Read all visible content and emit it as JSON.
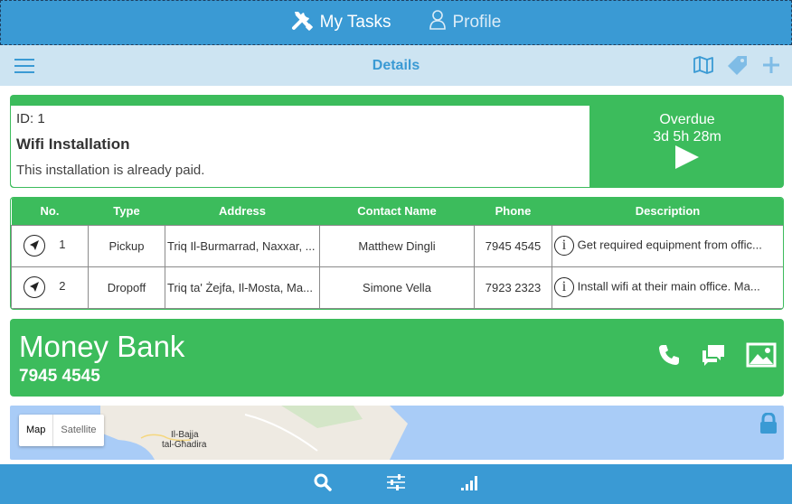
{
  "topbar": {
    "tabs": [
      {
        "label": "My Tasks",
        "icon": "tools-icon",
        "active": true
      },
      {
        "label": "Profile",
        "icon": "user-icon",
        "active": false
      }
    ]
  },
  "subbar": {
    "title": "Details",
    "icons": [
      "menu-icon",
      "map-icon",
      "tag-icon",
      "plus-icon"
    ]
  },
  "task": {
    "id": "ID: 1",
    "name": "Wifi Installation",
    "description": "This installation is already paid.",
    "status": "Overdue",
    "timer": "3d 5h 28m"
  },
  "stops": {
    "headers": [
      "No.",
      "Type",
      "Address",
      "Contact Name",
      "Phone",
      "Description"
    ],
    "rows": [
      {
        "no": "1",
        "type": "Pickup",
        "address": "Triq Il-Burmarrad, Naxxar, ...",
        "contact": "Matthew Dingli",
        "phone": "7945 4545",
        "description": "Get required equipment from offic..."
      },
      {
        "no": "2",
        "type": "Dropoff",
        "address": "Triq ta' Żejfa, Il-Mosta, Ma...",
        "contact": "Simone Vella",
        "phone": "7923 2323",
        "description": "Install wifi at their main office. Ma..."
      }
    ]
  },
  "company": {
    "name": "Money Bank",
    "phone": "7945 4545",
    "icons": [
      "phone-icon",
      "chat-icon",
      "image-icon"
    ]
  },
  "map": {
    "type_map": "Map",
    "type_satellite": "Satellite",
    "place_label_1": "Il-Bajja",
    "place_label_2": "tal-Għadira"
  },
  "bottombar": {
    "icons": [
      "search-icon",
      "sliders-icon",
      "signal-icon"
    ]
  },
  "colors": {
    "primary_blue": "#3a9ad4",
    "light_blue": "#cde4f2",
    "green": "#3cbc5c",
    "map_water": "#a9ccf7"
  }
}
